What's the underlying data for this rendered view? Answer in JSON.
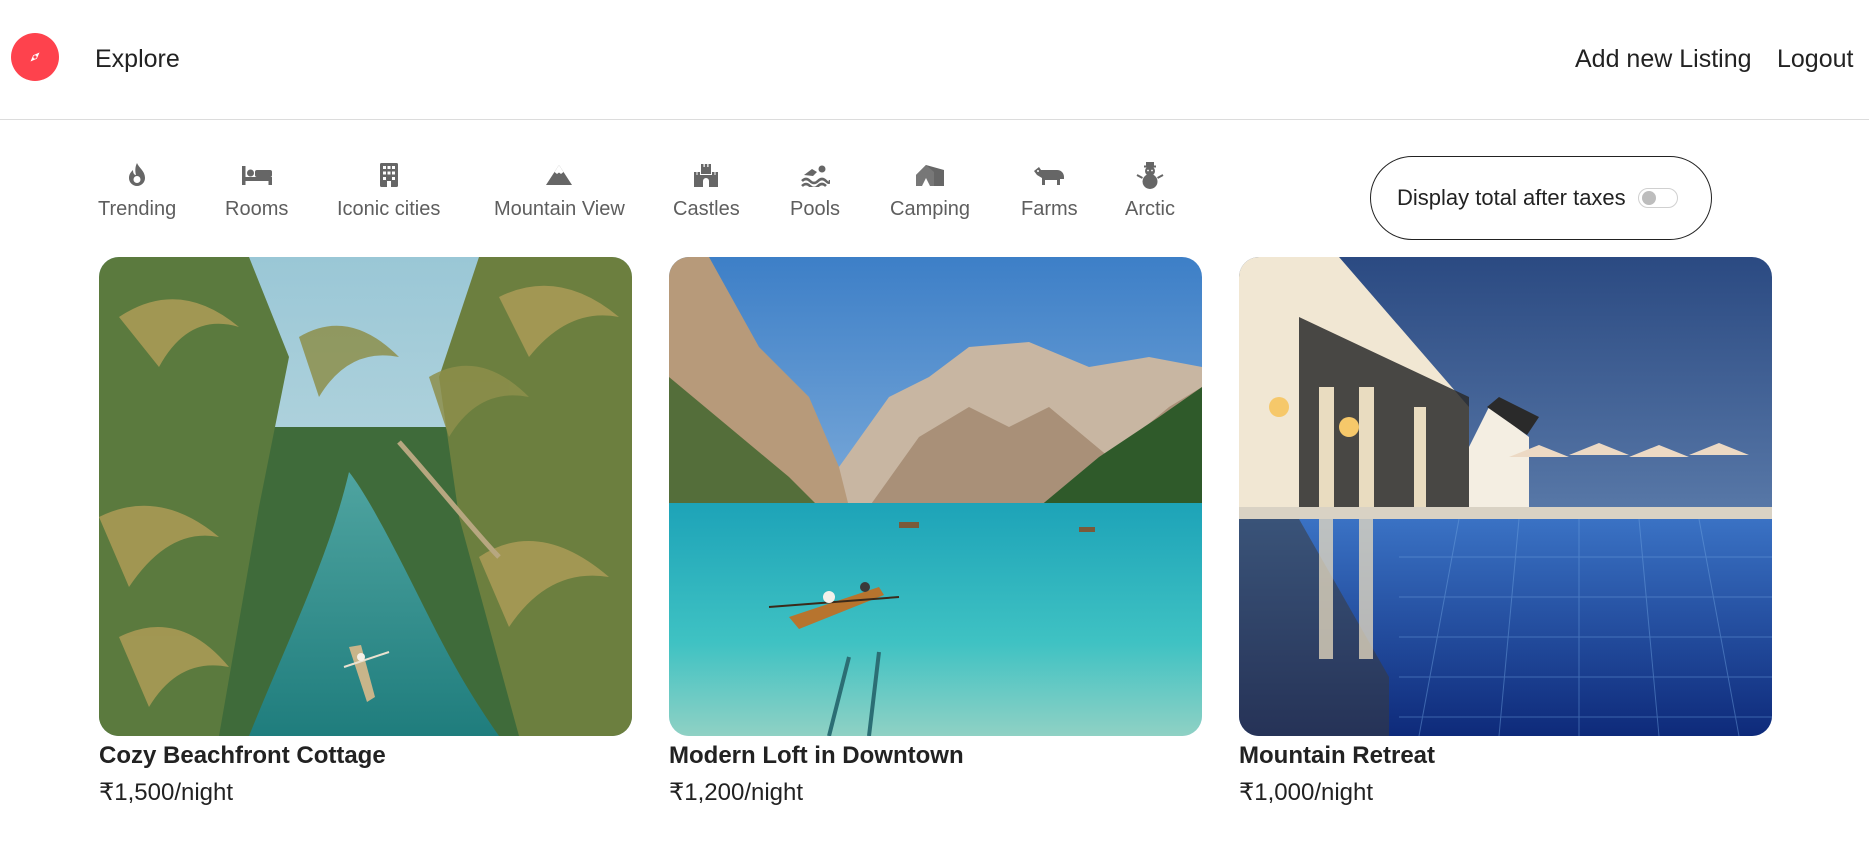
{
  "nav": {
    "explore_label": "Explore",
    "add_listing_label": "Add new Listing",
    "logout_label": "Logout",
    "brand_color": "#fe424d",
    "logo_icon": "compass-icon"
  },
  "filters": [
    {
      "label": "Trending",
      "icon": "fire-icon"
    },
    {
      "label": "Rooms",
      "icon": "bed-icon"
    },
    {
      "label": "Iconic cities",
      "icon": "building-icon"
    },
    {
      "label": "Mountain View",
      "icon": "mountain-icon"
    },
    {
      "label": "Castles",
      "icon": "castle-icon"
    },
    {
      "label": "Pools",
      "icon": "swimmer-icon"
    },
    {
      "label": "Camping",
      "icon": "campground-icon"
    },
    {
      "label": "Farms",
      "icon": "cow-icon"
    },
    {
      "label": "Arctic",
      "icon": "snowman-icon"
    }
  ],
  "tax_toggle": {
    "label": "Display total after taxes",
    "enabled": false
  },
  "listings": [
    {
      "title": "Cozy Beachfront Cottage",
      "price": "₹1,500/night"
    },
    {
      "title": "Modern Loft in Downtown",
      "price": "₹1,200/night"
    },
    {
      "title": "Mountain Retreat",
      "price": "₹1,000/night"
    }
  ]
}
